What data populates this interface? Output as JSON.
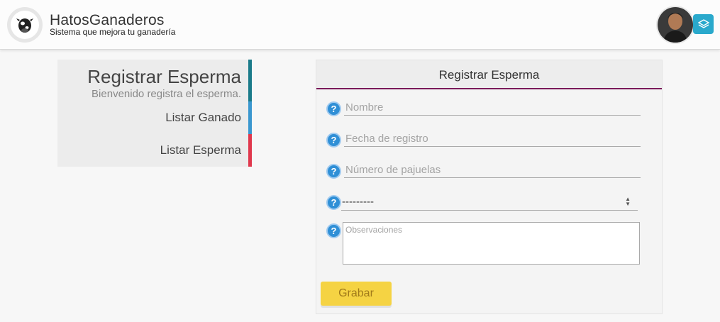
{
  "header": {
    "app_title": "HatosGanaderos",
    "app_subtitle": "Sistema que mejora tu ganadería",
    "logo_icon": "cow-icon",
    "avatar_icon": "user-avatar",
    "layers_icon": "layers-icon",
    "layers_color": "#2aa9cc"
  },
  "nav": {
    "main_title": "Registrar Esperma",
    "main_subtitle": "Bienvenido registra el esperma.",
    "items": [
      {
        "label": "Listar Ganado",
        "color": "#3a97cf"
      },
      {
        "label": "Listar Esperma",
        "color": "#e0384d"
      }
    ],
    "main_color": "#1a7b8a"
  },
  "form": {
    "title": "Registrar Esperma",
    "accent_color": "#7a1a5a",
    "fields": {
      "nombre_placeholder": "Nombre",
      "fecha_placeholder": "Fecha de registro",
      "pajuelas_placeholder": "Número de pajuelas",
      "select_value": "---------",
      "observaciones_placeholder": "Observaciones"
    },
    "help_glyph": "?",
    "submit_label": "Grabar",
    "submit_color": "#f5d343"
  }
}
